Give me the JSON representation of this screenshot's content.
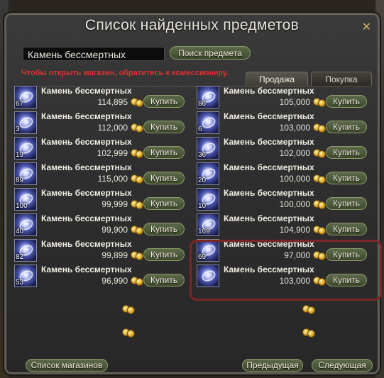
{
  "window": {
    "title": "Список найденных предметов",
    "close_icon": "close-x-icon"
  },
  "search": {
    "value": "Камень бессмертных",
    "button_label": "Поиск предмета"
  },
  "hint": "Чтобы открыть магазин, обратитесь к комиссионеру.",
  "tabs": [
    {
      "label": "Продажа",
      "active": true
    },
    {
      "label": "Покупка",
      "active": false
    }
  ],
  "buy_label": "Купить",
  "items_left": [
    {
      "qty": "67",
      "name": "Камень бессмертных",
      "price": "114,895"
    },
    {
      "qty": "3",
      "name": "Камень бессмертных",
      "price": "112,000"
    },
    {
      "qty": "19",
      "name": "Камень бессмертных",
      "price": "102,999"
    },
    {
      "qty": "89",
      "name": "Камень бессмертных",
      "price": "115,000"
    },
    {
      "qty": "100",
      "name": "Камень бессмертных",
      "price": "99,999"
    },
    {
      "qty": "40",
      "name": "Камень бессмертных",
      "price": "99,900"
    },
    {
      "qty": "82",
      "name": "Камень бессмертных",
      "price": "99,899"
    },
    {
      "qty": "53",
      "name": "Камень бессмертных",
      "price": "96,990"
    }
  ],
  "items_right": [
    {
      "qty": "86",
      "name": "Камень бессмертных",
      "price": "105,000"
    },
    {
      "qty": "6",
      "name": "Камень бессмертных",
      "price": "103,000"
    },
    {
      "qty": "36",
      "name": "Камень бессмертных",
      "price": "102,000"
    },
    {
      "qty": "20",
      "name": "Камень бессмертных",
      "price": "100,000"
    },
    {
      "qty": "10",
      "name": "Камень бессмертных",
      "price": "100,000"
    },
    {
      "qty": "169",
      "name": "Камень бессмертных",
      "price": "104,900"
    },
    {
      "qty": "69",
      "name": "Камень бессмертных",
      "price": "97,000"
    },
    {
      "qty": "",
      "name": "Камень бессмертных",
      "price": "103,000"
    }
  ],
  "footer": {
    "shops_label": "Список магазинов",
    "prev_label": "Предыдущая",
    "next_label": "Следующая"
  },
  "colors": {
    "hint": "#e03030",
    "highlight": "#7a2626",
    "button_bg": "#4d5a3c"
  }
}
